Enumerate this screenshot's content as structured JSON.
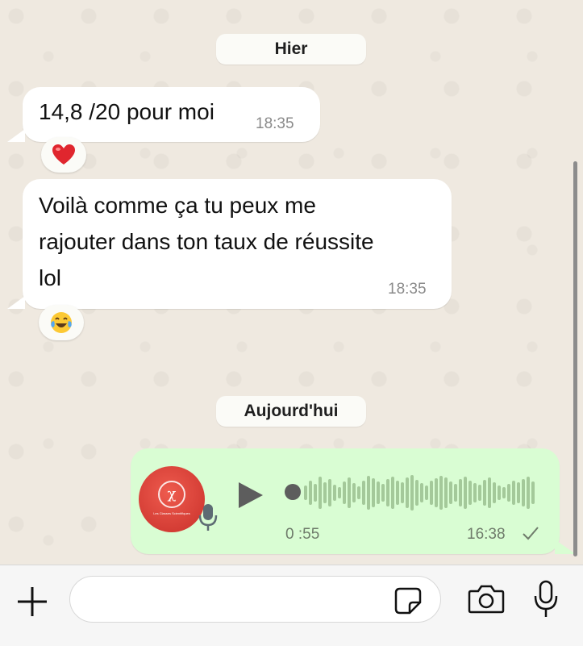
{
  "dates": {
    "yesterday": "Hier",
    "today": "Aujourd'hui"
  },
  "messages": [
    {
      "text": "14,8 /20 pour moi",
      "time": "18:35",
      "reaction": "heart"
    },
    {
      "lines": [
        "Voilà comme ça tu peux me",
        "rajouter dans ton taux de réussite",
        "lol"
      ],
      "time": "18:35",
      "reaction": "tears-of-joy"
    }
  ],
  "voice_note": {
    "duration": "0 :55",
    "time": "16:38",
    "status": "sent-check",
    "avatar_letter": "χ",
    "avatar_caption": "Les Classes Scientifiques"
  },
  "composer": {
    "placeholder": "",
    "value": ""
  },
  "colors": {
    "chat_bg": "#efe9e0",
    "outgoing_bubble": "#d9fdd3",
    "incoming_bubble": "#ffffff",
    "avatar": "#d9433b"
  },
  "icons": [
    "plus-icon",
    "sticker-icon",
    "camera-icon",
    "microphone-icon",
    "play-icon",
    "heart-emoji",
    "tears-of-joy-emoji",
    "checkmark-icon"
  ]
}
